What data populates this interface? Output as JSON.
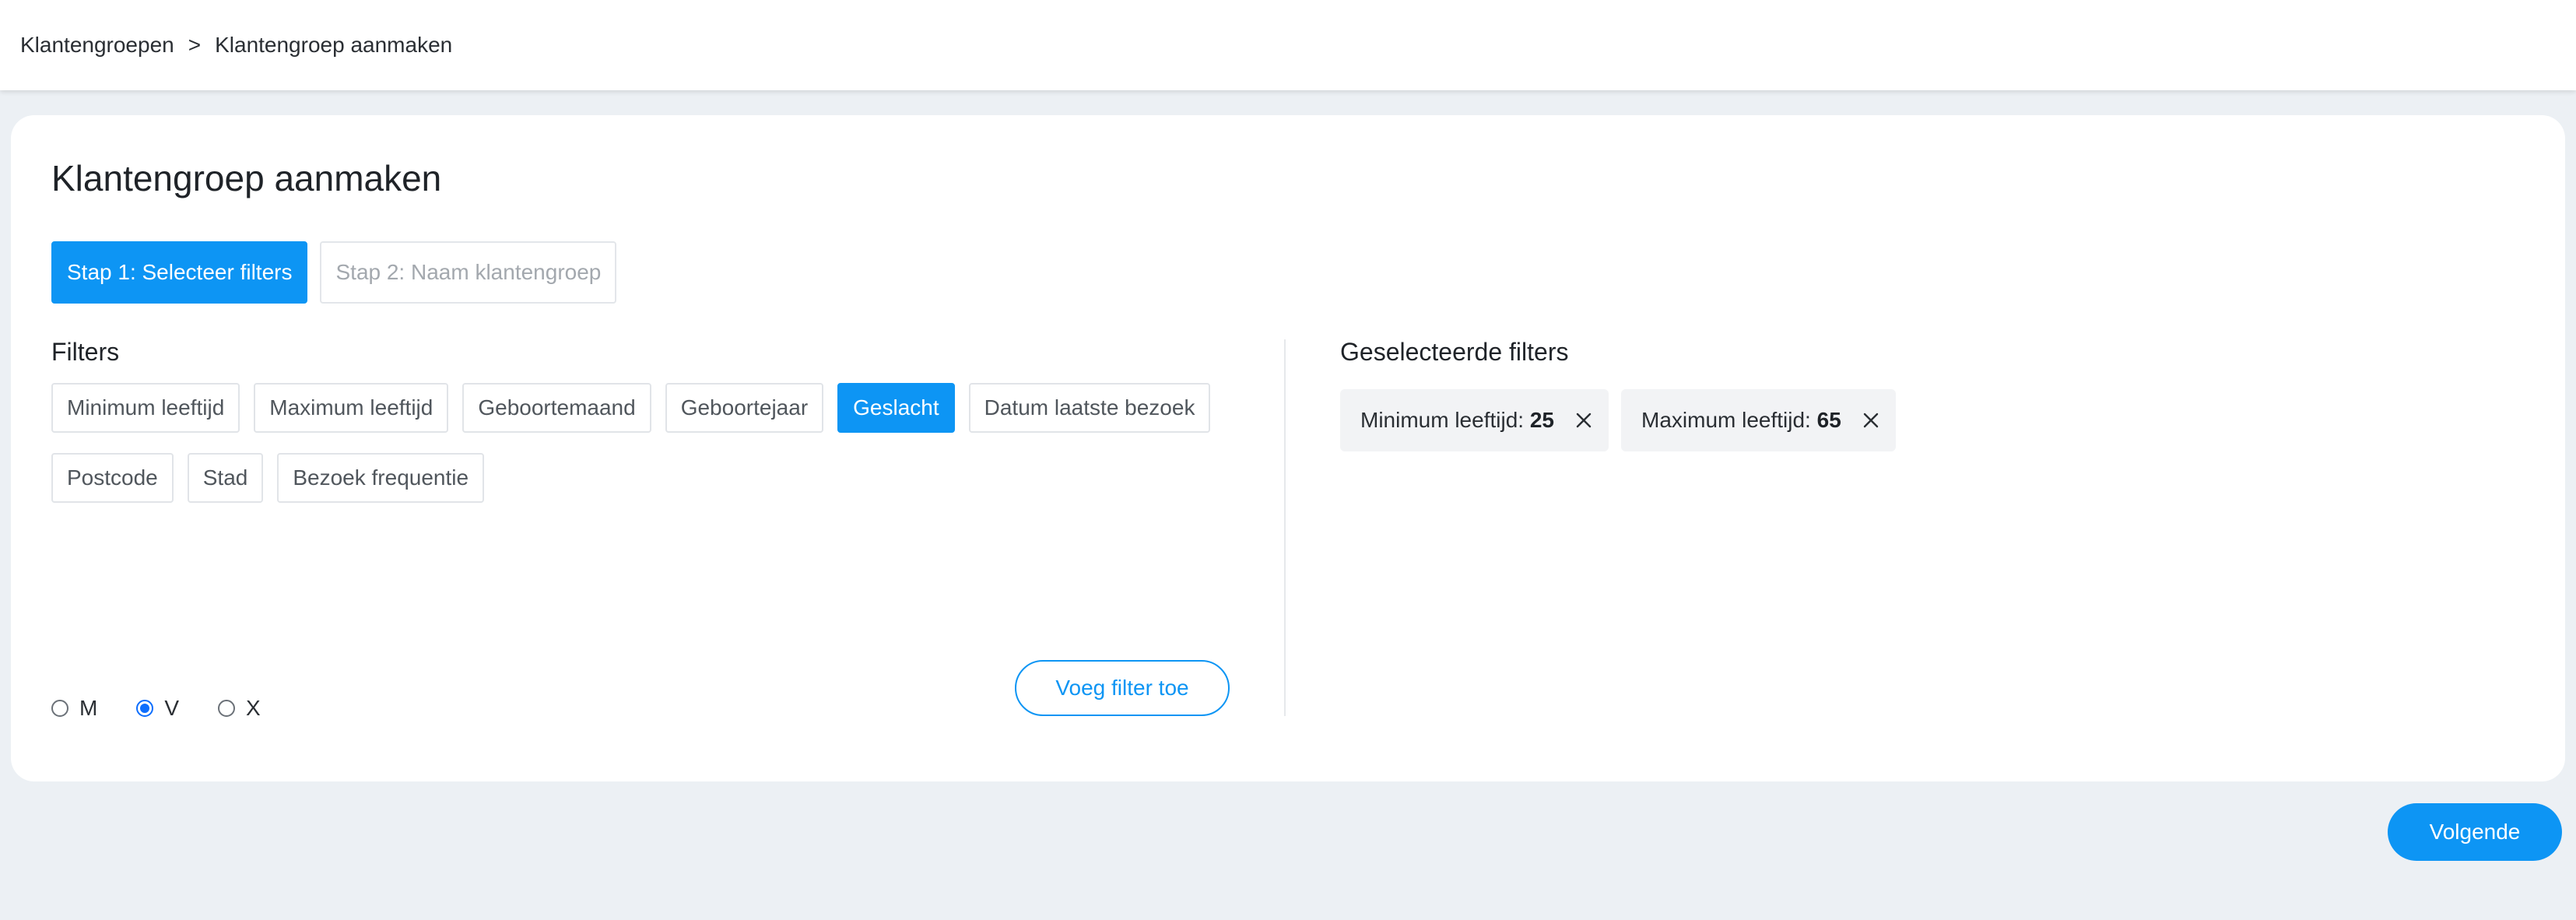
{
  "breadcrumb": {
    "parent": "Klantengroepen",
    "separator": ">",
    "current": "Klantengroep aanmaken"
  },
  "page": {
    "title": "Klantengroep aanmaken"
  },
  "steps": [
    {
      "label": "Stap 1: Selecteer filters",
      "active": true
    },
    {
      "label": "Stap 2: Naam klantengroep",
      "active": false
    }
  ],
  "filters": {
    "heading": "Filters",
    "items": [
      {
        "label": "Minimum leeftijd",
        "active": false
      },
      {
        "label": "Maximum leeftijd",
        "active": false
      },
      {
        "label": "Geboortemaand",
        "active": false
      },
      {
        "label": "Geboortejaar",
        "active": false
      },
      {
        "label": "Geslacht",
        "active": true
      },
      {
        "label": "Datum laatste bezoek",
        "active": false
      },
      {
        "label": "Postcode",
        "active": false
      },
      {
        "label": "Stad",
        "active": false
      },
      {
        "label": "Bezoek frequentie",
        "active": false
      }
    ],
    "gender_options": [
      {
        "label": "M",
        "checked": false
      },
      {
        "label": "V",
        "checked": true
      },
      {
        "label": "X",
        "checked": false
      }
    ],
    "add_button": "Voeg filter toe"
  },
  "selected": {
    "heading": "Geselecteerde filters",
    "items": [
      {
        "label": "Minimum leeftijd:",
        "value": "25"
      },
      {
        "label": "Maximum leeftijd:",
        "value": "65"
      }
    ]
  },
  "footer": {
    "next_button": "Volgende"
  },
  "colors": {
    "accent": "#0d95f4",
    "background": "#ecf0f4"
  }
}
